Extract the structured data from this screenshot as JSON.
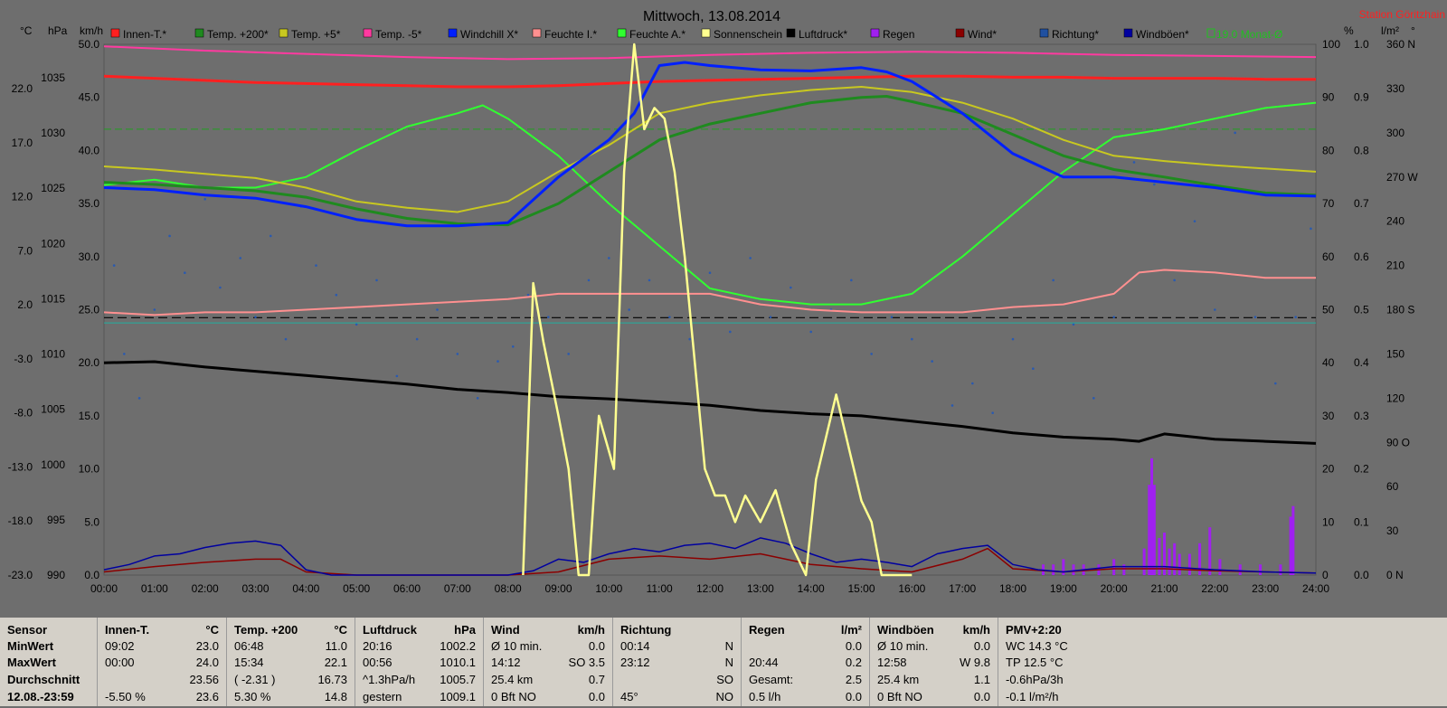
{
  "chart_data": {
    "type": "line",
    "title": "Mittwoch, 13.08.2014",
    "station": "Station Göritzhain",
    "x_ticks": [
      "00:00",
      "01:00",
      "02:00",
      "03:00",
      "04:00",
      "05:00",
      "06:00",
      "07:00",
      "08:00",
      "09:00",
      "10:00",
      "11:00",
      "12:00",
      "13:00",
      "14:00",
      "15:00",
      "16:00",
      "17:00",
      "18:00",
      "19:00",
      "20:00",
      "21:00",
      "22:00",
      "23:00",
      "24:00"
    ],
    "axes": {
      "temp_c": {
        "label": "°C",
        "ticks": [
          "22.0",
          "17.0",
          "12.0",
          "7.0",
          "2.0",
          "-3.0",
          "-8.0",
          "-13.0",
          "-18.0",
          "-23.0"
        ],
        "range": [
          -23,
          27
        ]
      },
      "pressure": {
        "label": "hPa",
        "ticks": [
          "1035",
          "1030",
          "1025",
          "1020",
          "1015",
          "1010",
          "1005",
          "1000",
          "995",
          "990"
        ],
        "range": [
          990,
          1040
        ]
      },
      "wind": {
        "label": "km/h",
        "ticks": [
          "50.0",
          "45.0",
          "40.0",
          "35.0",
          "30.0",
          "25.0",
          "20.0",
          "15.0",
          "10.0",
          "5.0",
          "0.0"
        ],
        "range": [
          0,
          50
        ]
      },
      "humidity": {
        "label": "%",
        "ticks": [
          "100",
          "90",
          "80",
          "70",
          "60",
          "50",
          "40",
          "30",
          "20",
          "10",
          "0"
        ],
        "range": [
          0,
          100
        ]
      },
      "rain": {
        "label": "l/m²",
        "ticks": [
          "1.0",
          "0.9",
          "0.8",
          "0.7",
          "0.6",
          "0.5",
          "0.4",
          "0.3",
          "0.2",
          "0.1",
          "0.0"
        ],
        "range": [
          0,
          1
        ]
      },
      "direction": {
        "label": "°",
        "ticks": [
          "360 N",
          "330",
          "300",
          "270 W",
          "240",
          "210",
          "180 S",
          "150",
          "120",
          "90 O",
          "60",
          "30",
          "0 N"
        ],
        "range": [
          0,
          360
        ]
      }
    },
    "legend": [
      {
        "name": "Innen-T.*",
        "color": "#ff2020"
      },
      {
        "name": "Temp. +200*",
        "color": "#1f8a1f"
      },
      {
        "name": "Temp. +5*",
        "color": "#c8c820"
      },
      {
        "name": "Temp. -5*",
        "color": "#ff3aa0"
      },
      {
        "name": "Windchill X*",
        "color": "#0020ff"
      },
      {
        "name": "Feuchte I.*",
        "color": "#ff9090"
      },
      {
        "name": "Feuchte A.*",
        "color": "#30ff30"
      },
      {
        "name": "Sonnenschein",
        "color": "#ffff90"
      },
      {
        "name": "Luftdruck*",
        "color": "#000000"
      },
      {
        "name": "Regen",
        "color": "#a020f0"
      },
      {
        "name": "Wind*",
        "color": "#8b0000"
      },
      {
        "name": "Richtung*",
        "color": "#2050a0"
      },
      {
        "name": "Windböen*",
        "color": "#0000a0"
      },
      {
        "name": "19.0 Monat-Ø",
        "color": "#20c020"
      }
    ],
    "ref_lines": [
      {
        "name": "19.0 Monat-Ø",
        "axis": "temp_c",
        "value": 19.0
      },
      {
        "name": "humidity-ref",
        "axis": "humidity",
        "value": 48.5
      },
      {
        "name": "teal-ref",
        "axis": "humidity",
        "value": 47.5
      }
    ],
    "series": [
      {
        "name": "Innen-T.*",
        "axis": "temp_c",
        "color": "#ff2020",
        "x": [
          0,
          1,
          2,
          3,
          4,
          5,
          6,
          7,
          8,
          9,
          10,
          11,
          12,
          13,
          14,
          15,
          16,
          17,
          18,
          19,
          20,
          21,
          22,
          23,
          24
        ],
        "y": [
          24.0,
          23.8,
          23.6,
          23.4,
          23.3,
          23.2,
          23.1,
          23.0,
          23.0,
          23.1,
          23.3,
          23.5,
          23.6,
          23.7,
          23.8,
          23.9,
          24.0,
          24.0,
          23.9,
          23.9,
          23.8,
          23.8,
          23.8,
          23.7,
          23.7
        ]
      },
      {
        "name": "Temp. +200*",
        "axis": "temp_c",
        "color": "#1f8a1f",
        "x": [
          0,
          1,
          2,
          3,
          4,
          5,
          6,
          7,
          8,
          9,
          10,
          11,
          12,
          13,
          14,
          15,
          15.5,
          16,
          17,
          18,
          19,
          20,
          21,
          22,
          23,
          24
        ],
        "y": [
          14.0,
          13.8,
          13.5,
          13.2,
          12.6,
          11.5,
          10.6,
          10.1,
          10.0,
          12.0,
          15.0,
          18.0,
          19.5,
          20.5,
          21.5,
          22.0,
          22.1,
          21.6,
          20.5,
          18.5,
          16.5,
          15.2,
          14.5,
          13.7,
          13.0,
          12.8
        ]
      },
      {
        "name": "Temp. +5*",
        "axis": "temp_c",
        "color": "#c8c820",
        "x": [
          0,
          1,
          2,
          3,
          4,
          5,
          6,
          7,
          8,
          9,
          10,
          11,
          12,
          13,
          14,
          15,
          16,
          17,
          18,
          19,
          20,
          21,
          22,
          23,
          24
        ],
        "y": [
          15.5,
          15.2,
          14.8,
          14.4,
          13.5,
          12.2,
          11.6,
          11.2,
          12.2,
          15.0,
          17.5,
          20.5,
          21.5,
          22.2,
          22.7,
          23.0,
          22.5,
          21.5,
          20.0,
          18.0,
          16.5,
          16.0,
          15.6,
          15.3,
          15.0
        ]
      },
      {
        "name": "Temp. -5*",
        "axis": "temp_c",
        "color": "#ff3aa0",
        "x": [
          0,
          2,
          4,
          6,
          8,
          10,
          12,
          14,
          16,
          18,
          20,
          22,
          24
        ],
        "y": [
          26.8,
          26.4,
          26.1,
          25.8,
          25.6,
          25.7,
          26.0,
          26.2,
          26.3,
          26.2,
          26.0,
          25.9,
          25.8
        ]
      },
      {
        "name": "Windchill X*",
        "axis": "temp_c",
        "color": "#0020ff",
        "x": [
          0,
          1,
          2,
          3,
          4,
          5,
          6,
          7,
          8,
          9,
          10,
          10.5,
          11,
          11.5,
          12,
          13,
          14,
          15,
          15.5,
          16,
          17,
          18,
          19,
          20,
          21,
          22,
          23,
          24
        ],
        "y": [
          13.5,
          13.3,
          12.8,
          12.5,
          11.7,
          10.5,
          9.9,
          9.9,
          10.2,
          14.5,
          18.0,
          20.5,
          25.0,
          25.3,
          25.0,
          24.6,
          24.5,
          24.8,
          24.4,
          23.5,
          20.5,
          16.7,
          14.5,
          14.5,
          14.0,
          13.5,
          12.8,
          12.7
        ]
      },
      {
        "name": "Feuchte I.*",
        "axis": "humidity",
        "color": "#ff9090",
        "x": [
          0,
          1,
          2,
          3,
          4,
          5,
          6,
          7,
          8,
          9,
          10,
          11,
          12,
          13,
          14,
          15,
          16,
          17,
          18,
          19,
          20,
          20.5,
          21,
          22,
          23,
          24
        ],
        "y": [
          49.5,
          49.0,
          49.5,
          49.5,
          50.0,
          50.5,
          51.0,
          51.5,
          52.0,
          53.0,
          53.0,
          53.0,
          53.0,
          51.0,
          50.0,
          49.5,
          49.5,
          49.5,
          50.5,
          51.0,
          53.0,
          57.0,
          57.5,
          57.0,
          56.0,
          56.0
        ]
      },
      {
        "name": "Feuchte A.*",
        "axis": "humidity",
        "color": "#30ff30",
        "x": [
          0,
          1,
          2,
          3,
          4,
          5,
          6,
          7,
          7.5,
          8,
          9,
          10,
          11,
          12,
          13,
          14,
          15,
          16,
          17,
          18,
          19,
          20,
          21,
          22,
          23,
          24
        ],
        "y": [
          73.5,
          74.5,
          73.0,
          73.0,
          75.0,
          80.0,
          84.5,
          87.0,
          88.5,
          86.0,
          79.0,
          70.0,
          62.0,
          54.0,
          52.0,
          51.0,
          51.0,
          53.0,
          60.0,
          68.0,
          76.0,
          82.5,
          84.0,
          86.0,
          88.0,
          89.0
        ]
      },
      {
        "name": "Sonnenschein",
        "axis": "wind",
        "color": "#ffff90",
        "x": [
          8.3,
          8.5,
          8.7,
          9,
          9.2,
          9.4,
          9.6,
          9.8,
          10.1,
          10.3,
          10.5,
          10.7,
          10.9,
          11.1,
          11.3,
          11.5,
          11.7,
          11.9,
          12.1,
          12.3,
          12.5,
          12.7,
          13,
          13.3,
          13.6,
          13.9,
          14.1,
          14.3,
          14.5,
          14.8,
          15,
          15.2,
          15.4,
          15.6,
          15.8,
          16
        ],
        "y": [
          0,
          27.5,
          22.0,
          15.0,
          10.0,
          0,
          0,
          15.0,
          10.0,
          38.0,
          50.0,
          42.0,
          44.0,
          43.0,
          38.0,
          30.0,
          20.0,
          10.0,
          7.5,
          7.5,
          5.0,
          7.5,
          5.0,
          8.0,
          3.0,
          0,
          9.0,
          13.0,
          17.0,
          11.0,
          7.0,
          5.0,
          0,
          0,
          0,
          0
        ]
      },
      {
        "name": "Luftdruck*",
        "axis": "pressure",
        "color": "#000000",
        "x": [
          0,
          1,
          2,
          3,
          4,
          5,
          6,
          7,
          8,
          9,
          10,
          11,
          12,
          13,
          14,
          15,
          16,
          17,
          18,
          19,
          20,
          20.5,
          21,
          22,
          23,
          24
        ],
        "y": [
          1010.0,
          1010.1,
          1009.6,
          1009.2,
          1008.8,
          1008.4,
          1008.0,
          1007.5,
          1007.2,
          1006.8,
          1006.6,
          1006.3,
          1006.0,
          1005.5,
          1005.2,
          1005.0,
          1004.5,
          1004.0,
          1003.4,
          1003.0,
          1002.8,
          1002.6,
          1003.3,
          1002.8,
          1002.6,
          1002.4
        ]
      },
      {
        "name": "Wind*",
        "axis": "wind",
        "color": "#8b0000",
        "x": [
          0,
          1,
          2,
          3,
          3.5,
          4,
          5,
          6,
          7,
          8,
          9,
          10,
          11,
          12,
          13,
          13.5,
          14,
          15,
          16,
          17,
          17.5,
          18,
          19,
          20,
          21,
          22,
          23,
          24
        ],
        "y": [
          0.3,
          0.8,
          1.2,
          1.5,
          1.5,
          0.3,
          0,
          0,
          0,
          0,
          0.3,
          1.5,
          1.8,
          1.5,
          2.0,
          1.5,
          1.0,
          0.6,
          0.3,
          1.5,
          2.5,
          0.6,
          0.3,
          0.6,
          0.6,
          0.4,
          0.3,
          0.2
        ]
      },
      {
        "name": "Windböen*",
        "axis": "wind",
        "color": "#0000a0",
        "x": [
          0,
          0.5,
          1,
          1.5,
          2,
          2.5,
          3,
          3.5,
          4,
          4.5,
          5,
          6,
          7,
          8,
          8.5,
          9,
          9.5,
          10,
          10.5,
          11,
          11.5,
          12,
          12.5,
          13,
          13.5,
          14,
          14.5,
          15,
          15.5,
          16,
          16.5,
          17,
          17.5,
          18,
          18.5,
          19,
          20,
          21,
          22,
          23,
          24
        ],
        "y": [
          0.5,
          1.0,
          1.8,
          2.0,
          2.6,
          3.0,
          3.2,
          2.8,
          0.5,
          0,
          0,
          0,
          0,
          0,
          0.4,
          1.5,
          1.2,
          2.0,
          2.5,
          2.2,
          2.8,
          3.0,
          2.5,
          3.5,
          3.0,
          2.0,
          1.2,
          1.5,
          1.2,
          0.8,
          2.0,
          2.5,
          2.8,
          1.0,
          0.5,
          0.3,
          0.8,
          0.8,
          0.5,
          0.3,
          0.2
        ]
      },
      {
        "name": "Regen",
        "axis": "rain",
        "color": "#a020f0",
        "x": [
          18.6,
          18.8,
          19.0,
          19.2,
          19.4,
          19.7,
          20.0,
          20.2,
          20.6,
          20.7,
          20.75,
          20.8,
          20.9,
          21.0,
          21.1,
          21.2,
          21.3,
          21.5,
          21.7,
          21.9,
          22.1,
          22.5,
          22.9,
          23.3,
          23.5,
          23.55
        ],
        "y": [
          0.02,
          0.02,
          0.03,
          0.02,
          0.02,
          0.02,
          0.03,
          0.02,
          0.05,
          0.17,
          0.22,
          0.17,
          0.07,
          0.08,
          0.05,
          0.06,
          0.04,
          0.04,
          0.06,
          0.09,
          0.03,
          0.02,
          0.02,
          0.02,
          0.11,
          0.13
        ]
      }
    ],
    "direction_samples": {
      "x": [
        0.2,
        0.4,
        0.7,
        1.0,
        1.3,
        1.6,
        2.0,
        2.3,
        2.7,
        3.0,
        3.3,
        3.6,
        3.9,
        4.2,
        4.6,
        5.0,
        5.4,
        5.8,
        6.2,
        6.6,
        7.0,
        7.4,
        7.8,
        8.1,
        8.4,
        8.8,
        9.2,
        9.6,
        10.0,
        10.4,
        10.8,
        11.2,
        11.6,
        12.0,
        12.4,
        12.8,
        13.2,
        13.6,
        14.0,
        14.4,
        14.8,
        15.2,
        15.6,
        16.0,
        16.4,
        16.8,
        17.2,
        17.6,
        18.0,
        18.4,
        18.8,
        19.2,
        19.6,
        20.0,
        20.4,
        20.8,
        21.2,
        21.6,
        22.0,
        22.4,
        22.8,
        23.2,
        23.6,
        23.9
      ],
      "y": [
        210,
        150,
        120,
        180,
        230,
        205,
        255,
        195,
        215,
        175,
        230,
        160,
        250,
        210,
        190,
        170,
        200,
        135,
        160,
        180,
        150,
        120,
        145,
        155,
        190,
        175,
        150,
        200,
        215,
        180,
        200,
        175,
        160,
        205,
        165,
        215,
        175,
        195,
        165,
        180,
        200,
        150,
        175,
        160,
        145,
        115,
        130,
        110,
        160,
        140,
        200,
        170,
        120,
        175,
        280,
        265,
        200,
        240,
        180,
        300,
        175,
        130,
        175,
        235
      ]
    }
  },
  "table": {
    "sensor": {
      "header": "Sensor",
      "rows": [
        "MinWert",
        "MaxWert",
        "Durchschnitt",
        "12.08.-23:59"
      ]
    },
    "innen": {
      "header": "Innen-T.",
      "unit": "°C",
      "rows": [
        [
          "09:02",
          "23.0"
        ],
        [
          "00:00",
          "24.0"
        ],
        [
          "",
          "23.56"
        ],
        [
          "-5.50 %",
          "23.6"
        ]
      ]
    },
    "temp200": {
      "header": "Temp. +200",
      "unit": "°C",
      "rows": [
        [
          "06:48",
          "11.0"
        ],
        [
          "15:34",
          "22.1"
        ],
        [
          "( -2.31 )",
          "16.73"
        ],
        [
          "5.30 %",
          "14.8"
        ]
      ]
    },
    "druck": {
      "header": "Luftdruck",
      "unit": "hPa",
      "rows": [
        [
          "20:16",
          "1002.2"
        ],
        [
          "00:56",
          "1010.1"
        ],
        [
          "^1.3hPa/h",
          "1005.7"
        ],
        [
          "gestern",
          "1009.1"
        ]
      ]
    },
    "wind": {
      "header": "Wind",
      "unit": "km/h",
      "rows": [
        [
          "Ø 10 min.",
          "0.0"
        ],
        [
          "14:12",
          "SO 3.5"
        ],
        [
          "25.4 km",
          "0.7"
        ],
        [
          "0 Bft NO",
          "0.0"
        ]
      ]
    },
    "richtung": {
      "header": "Richtung",
      "unit": "",
      "rows": [
        [
          "00:14",
          "N"
        ],
        [
          "23:12",
          "N"
        ],
        [
          "",
          "SO"
        ],
        [
          "45°",
          "NO"
        ]
      ]
    },
    "regen": {
      "header": "Regen",
      "unit": "l/m²",
      "rows": [
        [
          "",
          "0.0"
        ],
        [
          "20:44",
          "0.2"
        ],
        [
          "Gesamt:",
          "2.5"
        ],
        [
          "0.5 l/h",
          "0.0"
        ]
      ]
    },
    "boeen": {
      "header": "Windböen",
      "unit": "km/h",
      "rows": [
        [
          "Ø 10 min.",
          "0.0"
        ],
        [
          "12:58",
          "W 9.8"
        ],
        [
          "25.4 km",
          "1.1"
        ],
        [
          "0 Bft NO",
          "0.0"
        ]
      ]
    },
    "pmv": {
      "header": "PMV+2:20",
      "rows": [
        "WC 14.3 °C",
        "TP 12.5 °C",
        "-0.6hPa/3h",
        "-0.1 l/m²/h"
      ]
    }
  }
}
